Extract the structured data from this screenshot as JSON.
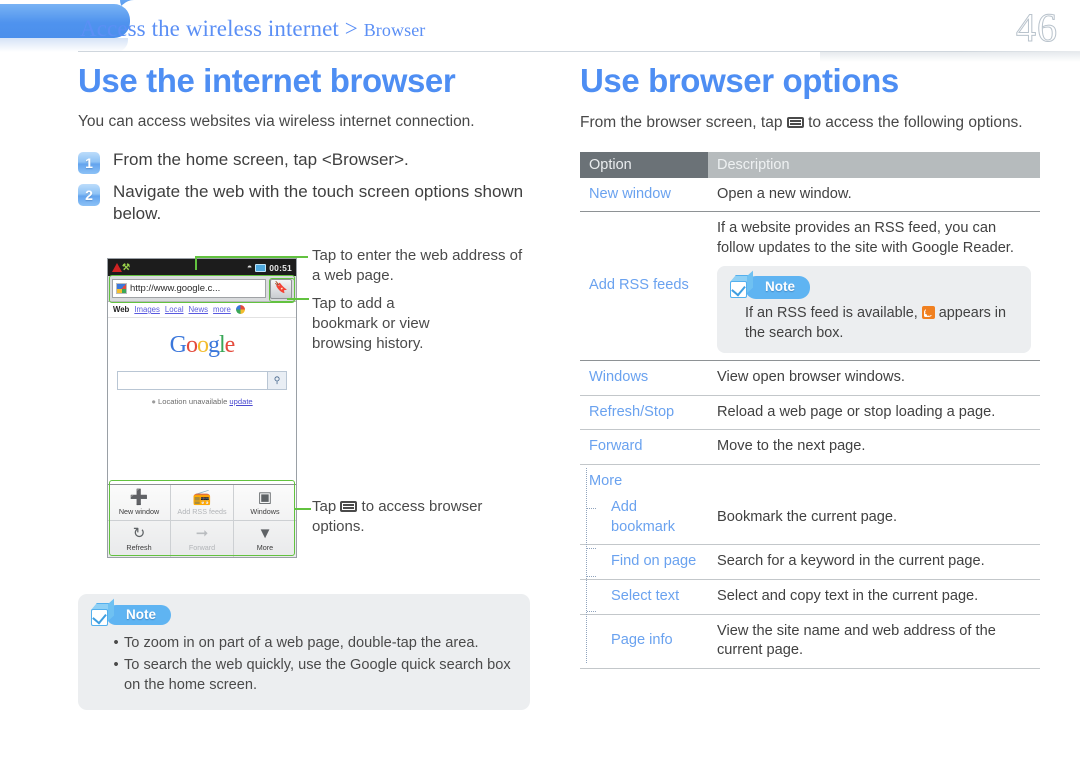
{
  "header": {
    "breadcrumb_main": "Access the wireless internet >",
    "breadcrumb_sub": "Browser",
    "page_number": "46"
  },
  "left": {
    "title": "Use the internet browser",
    "lead": "You can access websites via wireless internet connection.",
    "steps": [
      {
        "num": "1",
        "text": "From the home screen, tap <Browser>."
      },
      {
        "num": "2",
        "text": "Navigate the web with the touch screen options shown below."
      }
    ],
    "phone": {
      "status": {
        "warning_icon": "warning-triangle-icon",
        "usb_icon": "usb-icon",
        "wifi_icon": "wifi-icon",
        "battery_icon": "battery-icon",
        "clock": "00:51"
      },
      "url": "http://www.google.c...",
      "bookmark_button_icon": "bookmark-icon",
      "tabs": [
        "Web",
        "Images",
        "Local",
        "News",
        "more"
      ],
      "logo": "Google",
      "search_placeholder": "",
      "location_text": "Location unavailable",
      "location_link": "update",
      "toolbar": [
        {
          "label": "New window",
          "icon": "plus-circle-icon",
          "dimmed": false
        },
        {
          "label": "Add RSS feeds",
          "icon": "rss-icon",
          "dimmed": true
        },
        {
          "label": "Windows",
          "icon": "windows-stack-icon",
          "dimmed": false
        },
        {
          "label": "Refresh",
          "icon": "refresh-icon",
          "dimmed": false
        },
        {
          "label": "Forward",
          "icon": "arrow-right-icon",
          "dimmed": true
        },
        {
          "label": "More",
          "icon": "chevron-down-circle-icon",
          "dimmed": false
        }
      ]
    },
    "callouts": {
      "url_bar": "Tap to enter the web address of a web page.",
      "bookmark": "Tap to add a bookmark or view browsing history.",
      "menu_pre": "Tap",
      "menu_post": "to access browser options."
    },
    "note": {
      "label": "Note",
      "items": [
        "To zoom in on part of a web page, double-tap the area.",
        "To search the web quickly, use the Google quick search box on the home screen."
      ]
    }
  },
  "right": {
    "title": "Use browser options",
    "intro_pre": "From the browser screen, tap",
    "intro_post": "to access the following options.",
    "table": {
      "headers": {
        "option": "Option",
        "description": "Description"
      },
      "rows": [
        {
          "option": "New window",
          "description": "Open a new window."
        },
        {
          "option": "Add RSS feeds",
          "description": "If a website provides an RSS feed, you can follow updates to the site with Google Reader.",
          "note": {
            "label": "Note",
            "text_pre": "If an RSS feed is available,",
            "text_post": "appears in the search box."
          }
        },
        {
          "option": "Windows",
          "description": "View open browser windows."
        },
        {
          "option": "Refresh/Stop",
          "description": "Reload a web page or stop loading a page."
        },
        {
          "option": "Forward",
          "description": "Move to the next page."
        },
        {
          "option": "More",
          "description": ""
        },
        {
          "option": "Add bookmark",
          "description": "Bookmark the current page.",
          "sub": true
        },
        {
          "option": "Find on page",
          "description": "Search for a keyword in the current page.",
          "sub": true
        },
        {
          "option": "Select text",
          "description": "Select and copy text in the current page.",
          "sub": true
        },
        {
          "option": "Page info",
          "description": "View the site name and web address of the current page.",
          "sub": true
        }
      ]
    }
  },
  "colors": {
    "accent_blue": "#4e8ef3",
    "link_blue": "#6aa2ef",
    "callout_green": "#62c23f",
    "note_bg": "#eceef0",
    "table_header_dark": "#6b7277",
    "table_header_light": "#b6bbbd"
  }
}
